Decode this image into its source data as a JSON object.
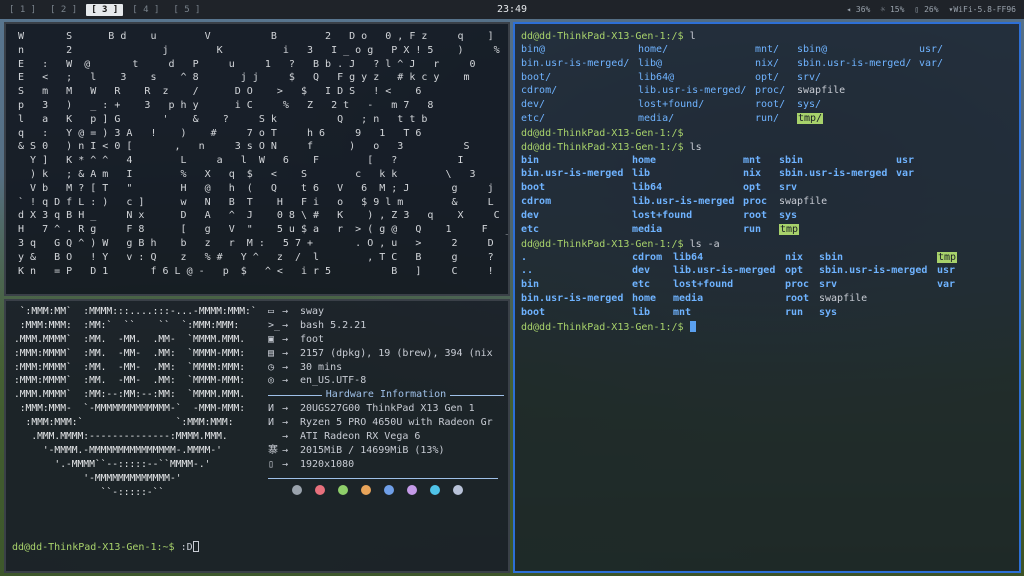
{
  "topbar": {
    "workspaces": [
      "[ 1 ]",
      "[ 2 ]",
      "[ 3 ]",
      "[ 4 ]",
      "[ 5 ]"
    ],
    "active_workspace": 2,
    "clock": "23:49",
    "status": {
      "volume": "◂ 36%",
      "brightness": "☼ 15%",
      "battery": "▯ 26%",
      "wifi": "WiFi-5.8-FF96"
    }
  },
  "matrix": {
    "lines": [
      "W       S      B d    u        V          B        2   D o   0 , F z     q    ]    V",
      "n       2               j        K          i   3   I _ o g   P X ! 5    )     %  0",
      "E   :   W  @       t     d   P     u     1   ?   B b . J   ? l ^ J   r     0",
      "E   <   ;   l    3    s    ^ 8       j j     $   Q   F g y z   # k c y    m",
      "S   m   M   W   R    R  z    /      D O    >   $   I D S   ! <    6",
      "p   3   )   _ : +    3   p h y      i C     %   Z   2 t   -   m 7   8",
      "l   a   K   p ] G       '    &    ?     S k          Q   ; n   t t b",
      "q   :   Y @ = ) 3 A   !    )    #     7 o T     h 6     9   1   T 6",
      "& S 0   ) n I < 0 [       ,   n     3 s O N     f      )   o   3          S",
      "  Y ]   K * ^ ^   4        L     a   l  W   6    F        [   ?          I",
      "  ) k   ; & A m   I        %   X   q  $   <    S        c   k k        \\   3",
      "  V b   M ? [ T   \"        H   @   h  (   Q    t 6   V   6  M ; J       g     j   (",
      "` ! q D f L : )   c ]      w   N   B  T    H   F i   o   $ 9 l m        &     L   n",
      "d X 3 q B H _     N x      D   A   ^  J    0 8 \\ #   K    ) , Z 3   q    X     C   \\",
      "H   7 ^ . R g     F 8      [   g   V  \"    5 u $ a   r  > ( g @   Q    1     F   _",
      "3 q   G Q ^ ) W   g B h    b   z   r  M :   5 7 +       . O , u   >     2     D   s",
      "y &   B O   ! Y   v : Q    z   % #   Y ^   z  /  l        , T C   B     g     ?   ;",
      "K n   = P   D 1       f 6 L @ -   p  $   ^ <   i r 5          B   ]     C     !   W   G"
    ]
  },
  "fetch": {
    "art": [
      " `:MMM:MM`  :MMMM:::....:::-...-MMMM:MMM:`",
      " :MMM:MMM:  :MM:`  ``    ``  `:MMM:MMM:",
      ".MMM.MMMM`  :MM.  -MM.  .MM-  `MMMM.MMM.",
      ":MMM:MMMM`  :MM.  -MM-  .MM:  `MMMM-MMM:",
      ":MMM:MMMM`  :MM.  -MM-  .MM:  `MMMM:MMM:",
      ":MMM:MMMM`  :MM.  -MM-  .MM:  `MMMM-MMM:",
      ".MMM.MMMM`  :MM:--:MM:--:MM:  `MMMM.MMM.",
      " :MMM:MMM-  `-MMMMMMMMMMMMM-`  -MMM-MMM:",
      "  :MMM:MMM:`                `:MMM:MMM:",
      "   .MMM.MMMM:--------------:MMMM.MMM.",
      "     '-MMMM.-MMMMMMMMMMMMMMM-.MMMM-'",
      "       '.-MMMM``--:::::--``MMMM-.'",
      "            '-MMMMMMMMMMMMM-'",
      "               ``-:::::-``"
    ],
    "arrow": "→",
    "rows_top": [
      {
        "icon": "▭",
        "value": "sway"
      },
      {
        "icon": ">_",
        "value": "bash 5.2.21"
      },
      {
        "icon": "▣",
        "value": "foot"
      },
      {
        "icon": "▤",
        "value": "2157 (dpkg), 19 (brew), 394 (nix"
      },
      {
        "icon": "◷",
        "value": "30 mins"
      },
      {
        "icon": "◎",
        "value": "en_US.UTF-8"
      }
    ],
    "hardware_title": "Hardware Information",
    "rows_hw": [
      {
        "icon": "И",
        "value": "20UGS27G00 ThinkPad X13 Gen 1"
      },
      {
        "icon": "И",
        "value": "Ryzen 5 PRO 4650U with Radeon Gr"
      },
      {
        "icon": "",
        "value": "ATI Radeon RX Vega 6"
      },
      {
        "icon": "寨",
        "value": "2015MiB / 14699MiB (13%)"
      },
      {
        "icon": "▯",
        "value": "1920x1080"
      }
    ],
    "palette": [
      "#9aa3ad",
      "#e8707c",
      "#8fcf6a",
      "#e8a45a",
      "#6f9fe8",
      "#c49ae8",
      "#4fc3e8",
      "#b8c2d8"
    ],
    "prompt": "dd@dd-ThinkPad-X13-Gen-1:~$",
    "command": ":D"
  },
  "term3": {
    "prompt": "dd@dd-ThinkPad-X13-Gen-1:/$",
    "cmd1": "l",
    "cmd2": "",
    "cmd3": "ls",
    "cmd4": "ls -a",
    "l_rows": [
      [
        "bin@",
        "home/",
        "mnt/",
        "sbin@",
        "usr/"
      ],
      [
        "bin.usr-is-merged/",
        "lib@",
        "nix/",
        "sbin.usr-is-merged/",
        "var/"
      ],
      [
        "boot/",
        "lib64@",
        "opt/",
        "srv/",
        ""
      ],
      [
        "cdrom/",
        "lib.usr-is-merged/",
        "proc/",
        "swapfile",
        ""
      ],
      [
        "dev/",
        "lost+found/",
        "root/",
        "sys/",
        ""
      ],
      [
        "etc/",
        "media/",
        "run/",
        "tmp/",
        ""
      ]
    ],
    "ls_rows": [
      [
        "bin",
        "home",
        "mnt",
        "sbin",
        "usr"
      ],
      [
        "bin.usr-is-merged",
        "lib",
        "nix",
        "sbin.usr-is-merged",
        "var"
      ],
      [
        "boot",
        "lib64",
        "opt",
        "srv",
        ""
      ],
      [
        "cdrom",
        "lib.usr-is-merged",
        "proc",
        "swapfile",
        ""
      ],
      [
        "dev",
        "lost+found",
        "root",
        "sys",
        ""
      ],
      [
        "etc",
        "media",
        "run",
        "tmp",
        ""
      ]
    ],
    "lsa_rows": [
      [
        ".",
        "cdrom",
        "lib64",
        "nix",
        "sbin",
        "tmp"
      ],
      [
        "..",
        "dev",
        "lib.usr-is-merged",
        "opt",
        "sbin.usr-is-merged",
        "usr"
      ],
      [
        "bin",
        "etc",
        "lost+found",
        "proc",
        "srv",
        "var"
      ],
      [
        "bin.usr-is-merged",
        "home",
        "media",
        "root",
        "swapfile",
        ""
      ],
      [
        "boot",
        "lib",
        "mnt",
        "run",
        "sys",
        ""
      ]
    ]
  }
}
